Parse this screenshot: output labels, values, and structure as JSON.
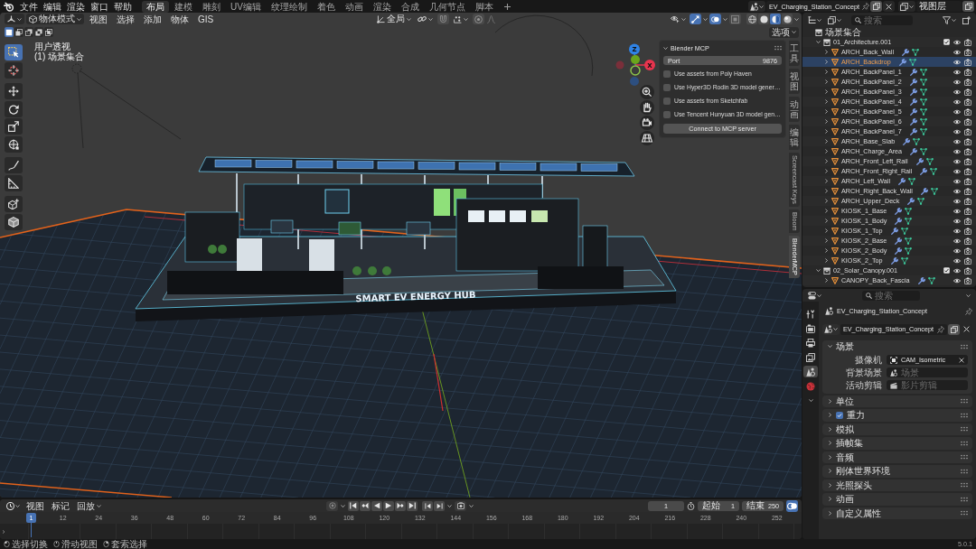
{
  "topbar": {
    "menus": [
      "文件",
      "编辑",
      "渲染",
      "窗口",
      "帮助"
    ],
    "workspaces": [
      {
        "label": "布局",
        "selected": true
      },
      {
        "label": "建模",
        "selected": false
      },
      {
        "label": "雕刻",
        "selected": false
      },
      {
        "label": "UV编辑",
        "selected": false
      },
      {
        "label": "纹理绘制",
        "selected": false
      },
      {
        "label": "着色",
        "selected": false
      },
      {
        "label": "动画",
        "selected": false
      },
      {
        "label": "渲染",
        "selected": false
      },
      {
        "label": "合成",
        "selected": false
      },
      {
        "label": "几何节点",
        "selected": false
      },
      {
        "label": "脚本",
        "selected": false
      }
    ],
    "scene": "EV_Charging_Station_Concept",
    "view_layer": "视图层"
  },
  "viewport": {
    "mode": "物体模式",
    "menus": [
      "视图",
      "选择",
      "添加",
      "物体",
      "GIS"
    ],
    "orientation": "全局",
    "toggles": [
      {
        "kind": "gizmo",
        "on": true
      },
      {
        "kind": "overlay",
        "on": true
      },
      {
        "kind": "xray",
        "on": false
      }
    ],
    "shading": [
      {
        "kind": "wireframe",
        "selected": false
      },
      {
        "kind": "solid",
        "selected": false
      },
      {
        "kind": "material",
        "selected": true
      },
      {
        "kind": "rendered",
        "selected": false
      }
    ],
    "options": "选项",
    "select_modes": [
      {
        "kind": "set",
        "selected": true
      },
      {
        "kind": "extend",
        "selected": false
      },
      {
        "kind": "subtract",
        "selected": false
      },
      {
        "kind": "invert",
        "selected": false
      },
      {
        "kind": "intersect",
        "selected": false
      }
    ],
    "view_name": "用户透视",
    "collection_label": "(1) 场景集合",
    "tools": [
      {
        "kind": "select",
        "selected": true
      },
      {
        "kind": "cursor",
        "selected": false
      },
      {
        "kind": "move",
        "selected": false
      },
      {
        "kind": "rotate",
        "selected": false
      },
      {
        "kind": "scale",
        "selected": false
      },
      {
        "kind": "transform",
        "selected": false
      },
      {
        "kind": "annotate",
        "selected": false
      },
      {
        "kind": "measure",
        "selected": false
      },
      {
        "kind": "add_cube",
        "selected": false
      },
      {
        "kind": "cube",
        "selected": false
      }
    ],
    "axes": [
      {
        "label": "Z",
        "color": "#2f83e6"
      },
      {
        "label": "X",
        "color": "#e8344e"
      }
    ],
    "sign": "SMART EV ENERGY HUB"
  },
  "sidebar": {
    "tabs": [
      {
        "label": "工具",
        "selected": false
      },
      {
        "label": "视图",
        "selected": false
      },
      {
        "label": "动画",
        "selected": false
      },
      {
        "label": "编辑",
        "selected": false
      },
      {
        "label": "Screencast Keys",
        "selected": false
      },
      {
        "label": "Bloom",
        "selected": false
      },
      {
        "label": "BlenderMCP",
        "selected": true
      }
    ],
    "panel": {
      "title": "Blender MCP",
      "expanded": true,
      "port_label": "Port",
      "port_value": "9876",
      "options": [
        {
          "label": "Use assets from Poly Haven",
          "checked": false
        },
        {
          "label": "Use Hyper3D Rodin 3D model gener…",
          "checked": false
        },
        {
          "label": "Use assets from Sketchfab",
          "checked": false
        },
        {
          "label": "Use Tencent Hunyuan 3D model gen…",
          "checked": false
        }
      ],
      "button": "Connect to MCP server"
    }
  },
  "outliner": {
    "search_placeholder": "搜索",
    "tree": [
      {
        "kind": "scene",
        "name": "场景集合",
        "selected": false,
        "children": [
          {
            "kind": "collection",
            "name": "01_Architecture.001",
            "expanded": true,
            "checked": true,
            "selected": false,
            "children": [
              {
                "kind": "object",
                "name": "ARCH_Back_Wall",
                "expanded": false,
                "selected": false
              },
              {
                "kind": "object",
                "name": "ARCH_Backdrop",
                "expanded": false,
                "selected": true
              },
              {
                "kind": "object",
                "name": "ARCH_BackPanel_1",
                "expanded": false,
                "selected": false
              },
              {
                "kind": "object",
                "name": "ARCH_BackPanel_2",
                "expanded": false,
                "selected": false
              },
              {
                "kind": "object",
                "name": "ARCH_BackPanel_3",
                "expanded": false,
                "selected": false
              },
              {
                "kind": "object",
                "name": "ARCH_BackPanel_4",
                "expanded": false,
                "selected": false
              },
              {
                "kind": "object",
                "name": "ARCH_BackPanel_5",
                "expanded": false,
                "selected": false
              },
              {
                "kind": "object",
                "name": "ARCH_BackPanel_6",
                "expanded": false,
                "selected": false
              },
              {
                "kind": "object",
                "name": "ARCH_BackPanel_7",
                "expanded": false,
                "selected": false
              },
              {
                "kind": "object",
                "name": "ARCH_Base_Slab",
                "expanded": false,
                "selected": false
              },
              {
                "kind": "object",
                "name": "ARCH_Charge_Area",
                "expanded": false,
                "selected": false
              },
              {
                "kind": "object",
                "name": "ARCH_Front_Left_Rail",
                "expanded": false,
                "selected": false
              },
              {
                "kind": "object",
                "name": "ARCH_Front_Right_Rail",
                "expanded": false,
                "selected": false
              },
              {
                "kind": "object",
                "name": "ARCH_Left_Wall",
                "expanded": false,
                "selected": false
              },
              {
                "kind": "object",
                "name": "ARCH_Right_Back_Wall",
                "expanded": false,
                "selected": false
              },
              {
                "kind": "object",
                "name": "ARCH_Upper_Deck",
                "expanded": false,
                "selected": false
              },
              {
                "kind": "object",
                "name": "KIOSK_1_Base",
                "expanded": false,
                "selected": false
              },
              {
                "kind": "object",
                "name": "KIOSK_1_Body",
                "expanded": false,
                "selected": false
              },
              {
                "kind": "object",
                "name": "KIOSK_1_Top",
                "expanded": false,
                "selected": false
              },
              {
                "kind": "object",
                "name": "KIOSK_2_Base",
                "expanded": false,
                "selected": false
              },
              {
                "kind": "object",
                "name": "KIOSK_2_Body",
                "expanded": false,
                "selected": false
              },
              {
                "kind": "object",
                "name": "KIOSK_2_Top",
                "expanded": false,
                "selected": false
              }
            ]
          },
          {
            "kind": "collection",
            "name": "02_Solar_Canopy.001",
            "expanded": true,
            "checked": true,
            "selected": false,
            "children": [
              {
                "kind": "object",
                "name": "CANOPY_Back_Fascia",
                "expanded": false,
                "selected": false
              }
            ]
          }
        ]
      }
    ]
  },
  "properties": {
    "search_placeholder": "搜索",
    "tabs": [
      {
        "kind": "tool",
        "selected": false
      },
      {
        "kind": "render",
        "selected": false
      },
      {
        "kind": "output",
        "selected": false
      },
      {
        "kind": "view_layer",
        "selected": false
      },
      {
        "kind": "scene",
        "selected": true
      },
      {
        "kind": "world",
        "selected": false
      }
    ],
    "context": "EV_Charging_Station_Concept",
    "scene": "EV_Charging_Station_Concept",
    "panels": [
      {
        "title": "场景",
        "expanded": true,
        "fields": [
          {
            "kind": "camera",
            "label": "摄像机",
            "value": "CAM_Isometric"
          },
          {
            "kind": "scene",
            "label": "背景场景",
            "placeholder": "场景"
          },
          {
            "kind": "clip",
            "label": "活动剪辑",
            "placeholder": "影片剪辑"
          }
        ]
      },
      {
        "title": "单位",
        "expanded": false
      },
      {
        "title": "重力",
        "expanded": false,
        "checked": true
      },
      {
        "title": "模拟",
        "expanded": false
      },
      {
        "title": "插帧集",
        "expanded": false
      },
      {
        "title": "音频",
        "expanded": false
      },
      {
        "title": "刚体世界环境",
        "expanded": false
      },
      {
        "title": "光照探头",
        "expanded": false
      },
      {
        "title": "动画",
        "expanded": false
      },
      {
        "title": "自定义属性",
        "expanded": false
      }
    ]
  },
  "timeline": {
    "menus": [
      {
        "kind": "menu",
        "label": "视图"
      },
      {
        "kind": "menu",
        "label": "标记"
      },
      {
        "kind": "dropdown",
        "label": "回放"
      }
    ],
    "current_frame": "1",
    "start_label": "起始",
    "start": "1",
    "end_label": "结束",
    "end": "250",
    "playhead": "1",
    "ticks": [
      "12",
      "24",
      "36",
      "48",
      "60",
      "72",
      "84",
      "96",
      "108",
      "120",
      "132",
      "144",
      "156",
      "168",
      "180",
      "192",
      "204",
      "216",
      "228",
      "240",
      "252"
    ]
  },
  "status_bar": {
    "hints": [
      {
        "kind": "left",
        "label": "选择切换"
      },
      {
        "kind": "middle",
        "label": "滑动视图"
      },
      {
        "kind": "right",
        "label": "套索选择"
      }
    ],
    "version": "5.0.1"
  }
}
